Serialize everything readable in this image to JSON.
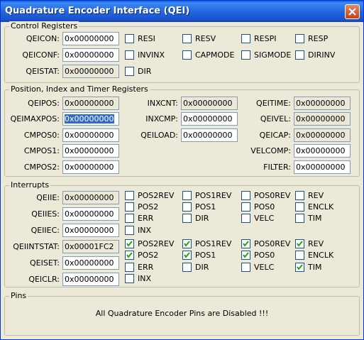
{
  "window": {
    "title": "Quadrature Encoder Interface (QEI)",
    "close_icon": "close-icon"
  },
  "control": {
    "title": "Control Registers",
    "rows": [
      {
        "label": "QEICON:",
        "value": "0x00000000",
        "readonly": false,
        "checks": [
          {
            "label": "RESI",
            "checked": false
          },
          {
            "label": "RESV",
            "checked": false
          },
          {
            "label": "RESPI",
            "checked": false
          },
          {
            "label": "RESP",
            "checked": false
          }
        ]
      },
      {
        "label": "QEICONF:",
        "value": "0x00000000",
        "readonly": false,
        "checks": [
          {
            "label": "INVINX",
            "checked": false
          },
          {
            "label": "CAPMODE",
            "checked": false
          },
          {
            "label": "SIGMODE",
            "checked": false
          },
          {
            "label": "DIRINV",
            "checked": false
          }
        ]
      },
      {
        "label": "QEISTAT:",
        "value": "0x00000000",
        "readonly": true,
        "checks": [
          {
            "label": "DIR",
            "checked": false
          }
        ]
      }
    ]
  },
  "position": {
    "title": "Position, Index and Timer Registers",
    "col1": [
      {
        "label": "QEIPOS:",
        "value": "0x00000000",
        "readonly": true
      },
      {
        "label": "QEIMAXPOS:",
        "value": "0x00000000",
        "readonly": false,
        "selected": true
      },
      {
        "label": "CMPOS0:",
        "value": "0x00000000",
        "readonly": false
      },
      {
        "label": "CMPOS1:",
        "value": "0x00000000",
        "readonly": false
      },
      {
        "label": "CMPOS2:",
        "value": "0x00000000",
        "readonly": false
      }
    ],
    "col2": [
      {
        "label": "INXCNT:",
        "value": "0x00000000",
        "readonly": true
      },
      {
        "label": "INXCMP:",
        "value": "0x00000000",
        "readonly": false
      },
      {
        "label": "QEILOAD:",
        "value": "0x00000000",
        "readonly": false
      }
    ],
    "col3": [
      {
        "label": "QEITIME:",
        "value": "0x00000000",
        "readonly": true
      },
      {
        "label": "QEIVEL:",
        "value": "0x00000000",
        "readonly": true
      },
      {
        "label": "QEICAP:",
        "value": "0x00000000",
        "readonly": true
      },
      {
        "label": "VELCOMP:",
        "value": "0x00000000",
        "readonly": false
      },
      {
        "label": "FILTER:",
        "value": "0x00000000",
        "readonly": false
      }
    ]
  },
  "interrupts": {
    "title": "Interrupts",
    "rows": [
      {
        "label": "QEIIE:",
        "value": "0x00000000",
        "readonly": true
      },
      {
        "label": "QEIIES:",
        "value": "0x00000000",
        "readonly": false
      },
      {
        "label": "QEIIEC:",
        "value": "0x00000000",
        "readonly": false
      },
      {
        "label": "QEIINTSTAT:",
        "value": "0x00001FC2",
        "readonly": true
      },
      {
        "label": "QEISET:",
        "value": "0x00000000",
        "readonly": false
      },
      {
        "label": "QEICLR:",
        "value": "0x00000000",
        "readonly": false
      }
    ],
    "checks_top": [
      [
        {
          "label": "POS2REV",
          "checked": false
        },
        {
          "label": "POS1REV",
          "checked": false
        },
        {
          "label": "POS0REV",
          "checked": false
        },
        {
          "label": "REV",
          "checked": false
        }
      ],
      [
        {
          "label": "POS2",
          "checked": false
        },
        {
          "label": "POS1",
          "checked": false
        },
        {
          "label": "POS0",
          "checked": false
        },
        {
          "label": "ENCLK",
          "checked": false
        }
      ],
      [
        {
          "label": "ERR",
          "checked": false
        },
        {
          "label": "DIR",
          "checked": false
        },
        {
          "label": "VELC",
          "checked": false
        },
        {
          "label": "TIM",
          "checked": false
        }
      ],
      [
        {
          "label": "INX",
          "checked": false
        }
      ]
    ],
    "checks_bottom": [
      [
        {
          "label": "POS2REV",
          "checked": true
        },
        {
          "label": "POS1REV",
          "checked": true
        },
        {
          "label": "POS0REV",
          "checked": true
        },
        {
          "label": "REV",
          "checked": true
        }
      ],
      [
        {
          "label": "POS2",
          "checked": true
        },
        {
          "label": "POS1",
          "checked": true
        },
        {
          "label": "POS0",
          "checked": true
        },
        {
          "label": "ENCLK",
          "checked": false
        }
      ],
      [
        {
          "label": "ERR",
          "checked": false
        },
        {
          "label": "DIR",
          "checked": false
        },
        {
          "label": "VELC",
          "checked": false
        },
        {
          "label": "TIM",
          "checked": true
        }
      ],
      [
        {
          "label": "INX",
          "checked": false
        }
      ]
    ]
  },
  "pins": {
    "title": "Pins",
    "message": "All Quadrature Encoder Pins are Disabled !!!"
  }
}
